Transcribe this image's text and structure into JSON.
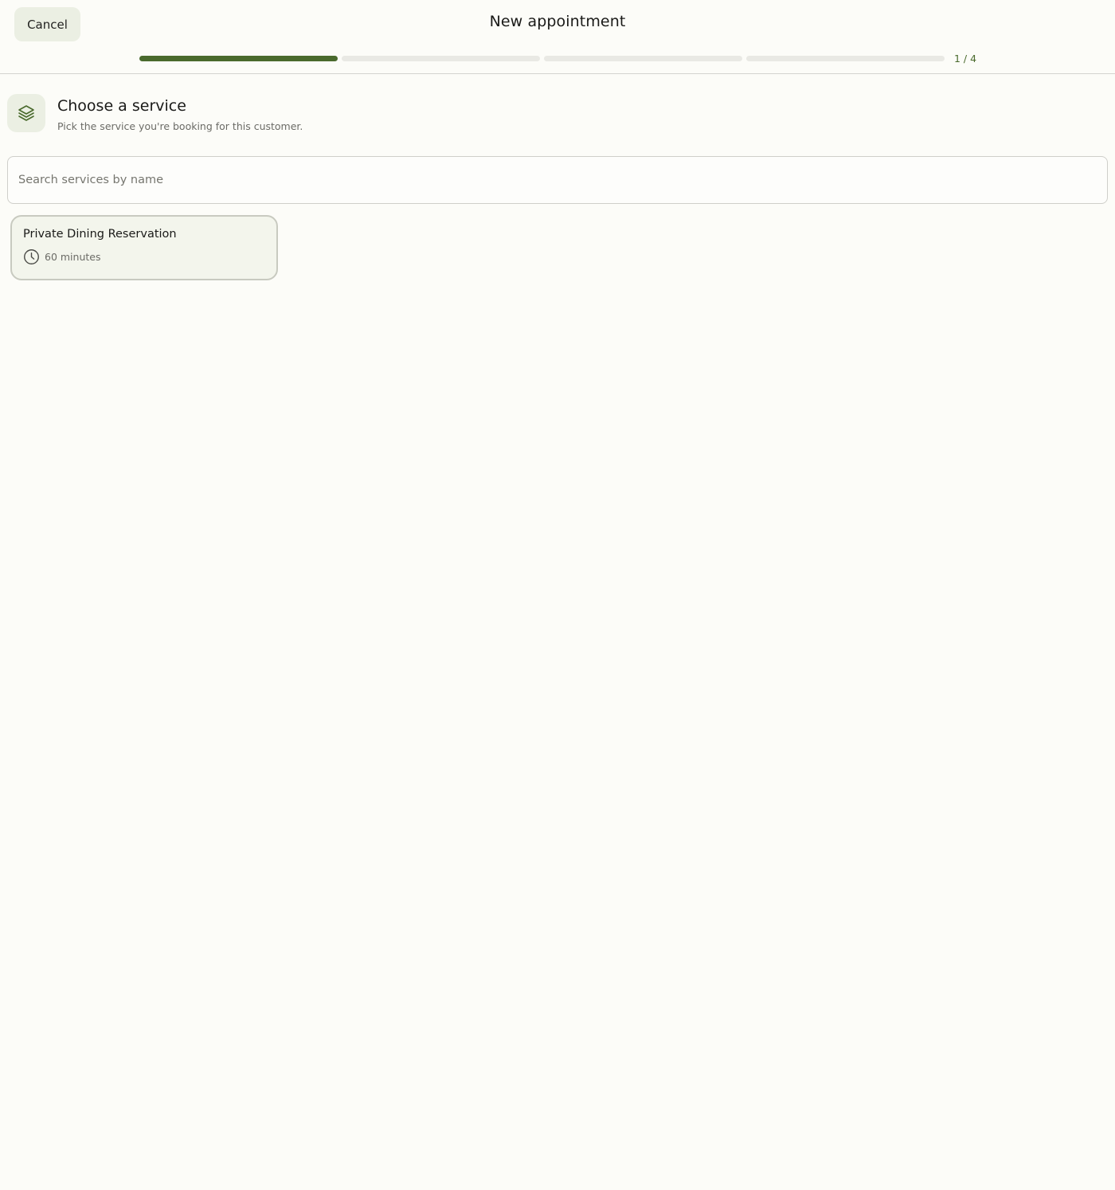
{
  "header": {
    "cancel_label": "Cancel",
    "title": "New appointment",
    "step_indicator": "1 / 4",
    "progress": {
      "current_step": 1,
      "total_steps": 4
    }
  },
  "section": {
    "icon": "layers-icon",
    "title": "Choose a service",
    "subtitle": "Pick the service you're booking for this customer."
  },
  "search": {
    "value": "",
    "placeholder": "Search services by name"
  },
  "services": [
    {
      "name": "Private Dining Reservation",
      "duration": "60 minutes",
      "icon": "clock-icon"
    }
  ],
  "colors": {
    "accent": "#4a6a2d",
    "background": "#fcfcf8",
    "chip_bg": "#ebefe3",
    "card_bg": "#f3f5ec"
  }
}
